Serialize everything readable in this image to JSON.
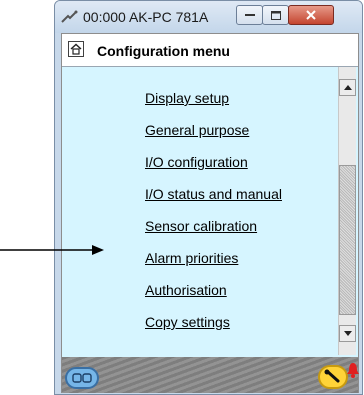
{
  "window": {
    "title": "00:000 AK-PC 781A"
  },
  "header": {
    "title": "Configuration menu"
  },
  "menu": {
    "items": [
      {
        "label": "Display setup"
      },
      {
        "label": "General purpose"
      },
      {
        "label": "I/O configuration"
      },
      {
        "label": "I/O status and manual"
      },
      {
        "label": "Sensor calibration"
      },
      {
        "label": "Alarm priorities"
      },
      {
        "label": "Authorisation"
      },
      {
        "label": "Copy settings"
      }
    ]
  },
  "colors": {
    "client_bg": "#d6f5ff",
    "status_alarm": "#e02020",
    "status_tool": "#ffd338"
  },
  "icons": {
    "app": "plug-icon",
    "home": "home-icon",
    "status_left": "controller-icon",
    "status_tool": "wrench-icon",
    "status_alarm": "alarm-bell-icon"
  }
}
